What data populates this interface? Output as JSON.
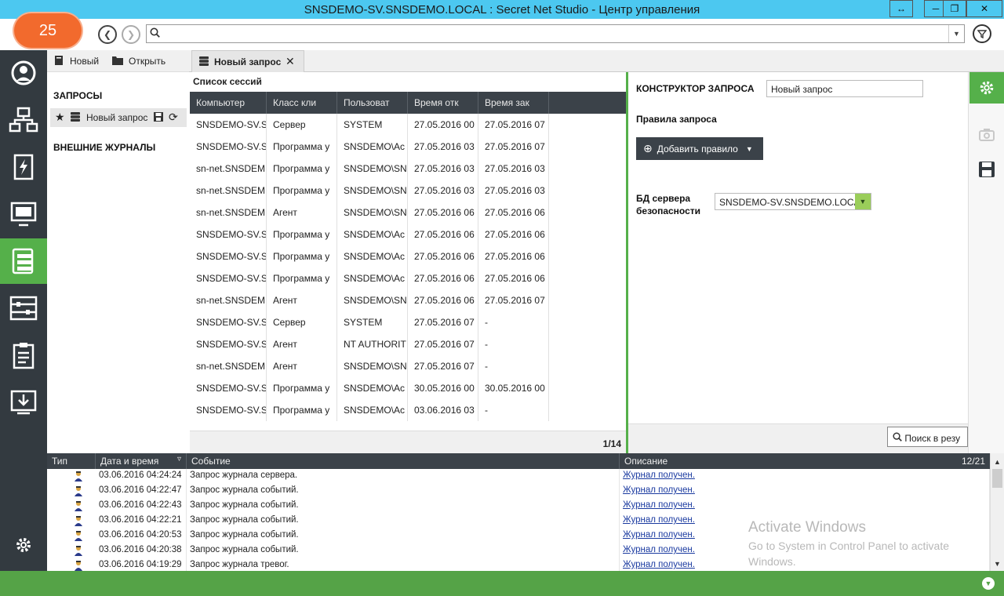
{
  "window": {
    "title": "SNSDEMO-SV.SNSDEMO.LOCAL : Secret Net Studio - Центр управления",
    "btn_restore": "↔",
    "btn_min": "─",
    "btn_max": "❐",
    "btn_close": "✕"
  },
  "toolbar": {
    "badge": "25",
    "search_value": "",
    "accent_orange": "#f26a2d"
  },
  "queries_panel": {
    "new_label": "Новый",
    "open_label": "Открыть",
    "queries_header": "ЗАПРОСЫ",
    "query_item": "Новый запрос",
    "ext_logs_header": "ВНЕШНИЕ ЖУРНАЛЫ"
  },
  "tab": {
    "label": "Новый запрос"
  },
  "sessions": {
    "title": "Список сессий",
    "columns": [
      "Компьютер",
      "Класс кли",
      "Пользоват",
      "Время отк",
      "Время зак"
    ],
    "rows": [
      [
        "SNSDEMO-SV.S",
        "Сервер",
        "SYSTEM",
        "27.05.2016 00",
        "27.05.2016 07"
      ],
      [
        "SNSDEMO-SV.S",
        "Программа у",
        "SNSDEMO\\Ac",
        "27.05.2016 03",
        "27.05.2016 07"
      ],
      [
        "sn-net.SNSDEM",
        "Программа у",
        "SNSDEMO\\SN",
        "27.05.2016 03",
        "27.05.2016 03"
      ],
      [
        "sn-net.SNSDEM",
        "Программа у",
        "SNSDEMO\\SN",
        "27.05.2016 03",
        "27.05.2016 03"
      ],
      [
        "sn-net.SNSDEM",
        "Агент",
        "SNSDEMO\\SN",
        "27.05.2016 06",
        "27.05.2016 06"
      ],
      [
        "SNSDEMO-SV.S",
        "Программа у",
        "SNSDEMO\\Ac",
        "27.05.2016 06",
        "27.05.2016 06"
      ],
      [
        "SNSDEMO-SV.S",
        "Программа у",
        "SNSDEMO\\Ac",
        "27.05.2016 06",
        "27.05.2016 06"
      ],
      [
        "SNSDEMO-SV.S",
        "Программа у",
        "SNSDEMO\\Ac",
        "27.05.2016 06",
        "27.05.2016 06"
      ],
      [
        "sn-net.SNSDEM",
        "Агент",
        "SNSDEMO\\SN",
        "27.05.2016 06",
        "27.05.2016 07"
      ],
      [
        "SNSDEMO-SV.S",
        "Сервер",
        "SYSTEM",
        "27.05.2016 07",
        "-"
      ],
      [
        "SNSDEMO-SV.S",
        "Агент",
        "NT AUTHORIT",
        "27.05.2016 07",
        "-"
      ],
      [
        "sn-net.SNSDEM",
        "Агент",
        "SNSDEMO\\SN",
        "27.05.2016 07",
        "-"
      ],
      [
        "SNSDEMO-SV.S",
        "Программа у",
        "SNSDEMO\\Ac",
        "30.05.2016 00",
        "30.05.2016 00"
      ],
      [
        "SNSDEMO-SV.S",
        "Программа у",
        "SNSDEMO\\Ac",
        "03.06.2016 03",
        "-"
      ]
    ],
    "pager": "1/14"
  },
  "constructor": {
    "label": "КОНСТРУКТОР ЗАПРОСА",
    "name_value": "Новый запрос",
    "rules_label": "Правила запроса",
    "add_rule": "Добавить правило",
    "db_label_line1": "БД сервера",
    "db_label_line2": "безопасности",
    "db_value": "SNSDEMO-SV.SNSDEMO.LOCAL",
    "search_results": "Поиск в резу"
  },
  "log": {
    "columns": [
      "Тип",
      "Дата и время",
      "Событие",
      "Описание"
    ],
    "count": "12/21",
    "rows": [
      [
        "03.06.2016 04:24:24",
        "Запрос журнала сервера.",
        "Журнал получен."
      ],
      [
        "03.06.2016 04:22:47",
        "Запрос журнала событий.",
        "Журнал получен."
      ],
      [
        "03.06.2016 04:22:43",
        "Запрос журнала событий.",
        "Журнал получен."
      ],
      [
        "03.06.2016 04:22:21",
        "Запрос журнала событий.",
        "Журнал получен."
      ],
      [
        "03.06.2016 04:20:53",
        "Запрос журнала событий.",
        "Журнал получен."
      ],
      [
        "03.06.2016 04:20:38",
        "Запрос журнала событий.",
        "Журнал получен."
      ],
      [
        "03.06.2016 04:19:29",
        "Запрос журнала тревог.",
        "Журнал получен."
      ]
    ]
  },
  "watermark": {
    "line1": "Activate Windows",
    "line2": "Go to System in Control Panel to activate Windows."
  },
  "colors": {
    "accent_green": "#55b04a",
    "title_blue": "#4cc8f0",
    "dark_header": "#3b4249"
  }
}
